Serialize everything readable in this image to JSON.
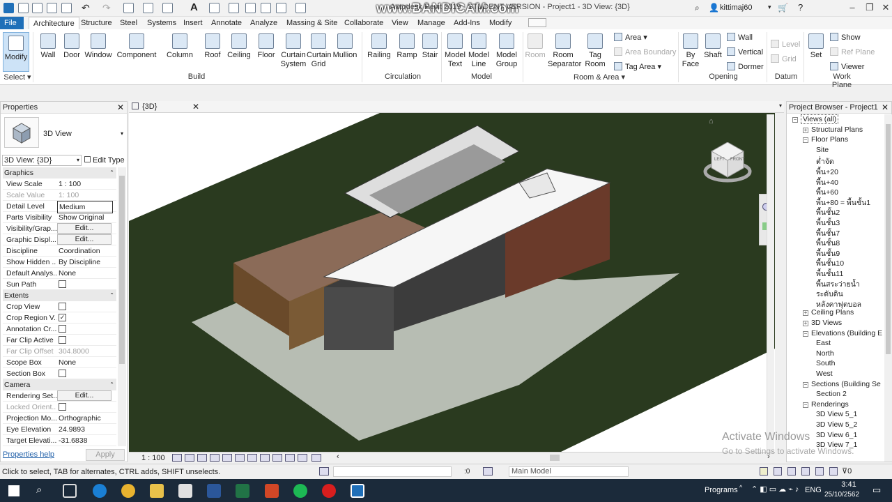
{
  "titlebar": {
    "title": "Autodesk Revit 2019 - STUDENT VERSION - Project1 - 3D View: {3D}",
    "watermark": "www.BANDICAM.com",
    "user": "kittimaj60"
  },
  "tabs": [
    "File",
    "Architecture",
    "Structure",
    "Steel",
    "Systems",
    "Insert",
    "Annotate",
    "Analyze",
    "Massing & Site",
    "Collaborate",
    "View",
    "Manage",
    "Add-Ins",
    "Modify"
  ],
  "ribbon": {
    "modify": "Modify",
    "select": "Select",
    "build_items": [
      "Wall",
      "Door",
      "Window",
      "Component",
      "Column",
      "Roof",
      "Ceiling",
      "Floor",
      "Curtain System",
      "Curtain Grid",
      "Mullion"
    ],
    "build_group": "Build",
    "circulation_items": [
      "Railing",
      "Ramp",
      "Stair"
    ],
    "circulation_group": "Circulation",
    "model_items": [
      "Model Text",
      "Model Line",
      "Model Group"
    ],
    "model_group": "Model",
    "room_items": [
      "Room",
      "Room Separator",
      "Tag Room"
    ],
    "room_small": [
      "Area",
      "Area Boundary",
      "Tag Area"
    ],
    "room_group": "Room & Area",
    "opening_items": [
      "By Face",
      "Shaft"
    ],
    "opening_small": [
      "Wall",
      "Vertical",
      "Dormer"
    ],
    "opening_group": "Opening",
    "datum_small": [
      "Level",
      "Grid"
    ],
    "datum_group": "Datum",
    "workplane_set": "Set",
    "workplane_small": [
      "Show",
      "Ref Plane",
      "Viewer"
    ],
    "workplane_group": "Work Plane"
  },
  "properties": {
    "header": "Properties",
    "type_name": "3D View",
    "selector": "3D View: {3D}",
    "edit_type": "Edit Type",
    "sections": {
      "graphics": "Graphics",
      "extents": "Extents",
      "camera": "Camera"
    },
    "graphics_rows": [
      {
        "k": "View Scale",
        "v": "1 : 100"
      },
      {
        "k": "Scale Value",
        "v": "1: 100"
      },
      {
        "k": "Detail Level",
        "v": "Medium"
      },
      {
        "k": "Parts Visibility",
        "v": "Show Original"
      },
      {
        "k": "Visibility/Grap...",
        "v": "Edit..."
      },
      {
        "k": "Graphic Displ...",
        "v": "Edit..."
      },
      {
        "k": "Discipline",
        "v": "Coordination"
      },
      {
        "k": "Show Hidden ...",
        "v": "By Discipline"
      },
      {
        "k": "Default Analys...",
        "v": "None"
      },
      {
        "k": "Sun Path",
        "v": ""
      }
    ],
    "extents_rows": [
      {
        "k": "Crop View",
        "v": ""
      },
      {
        "k": "Crop Region V...",
        "v": "✓"
      },
      {
        "k": "Annotation Cr...",
        "v": ""
      },
      {
        "k": "Far Clip Active",
        "v": ""
      },
      {
        "k": "Far Clip Offset",
        "v": "304.8000"
      },
      {
        "k": "Scope Box",
        "v": "None"
      },
      {
        "k": "Section Box",
        "v": ""
      }
    ],
    "camera_rows": [
      {
        "k": "Rendering Set...",
        "v": "Edit..."
      },
      {
        "k": "Locked Orient...",
        "v": ""
      },
      {
        "k": "Projection Mo...",
        "v": "Orthographic"
      },
      {
        "k": "Eye Elevation",
        "v": "24.9893"
      },
      {
        "k": "Target Elevati...",
        "v": "-31.6838"
      }
    ],
    "help": "Properties help",
    "apply": "Apply"
  },
  "view_tab": {
    "label": "{3D}"
  },
  "view_bar": {
    "scale": "1 : 100"
  },
  "browser": {
    "header": "Project Browser - Project1",
    "items": [
      {
        "label": "Views (all)",
        "level": 0,
        "box": "−"
      },
      {
        "label": "Structural Plans",
        "level": 1,
        "box": "+"
      },
      {
        "label": "Floor Plans",
        "level": 1,
        "box": "−"
      },
      {
        "label": "Site",
        "level": 2,
        "box": ""
      },
      {
        "label": "ต่ำจัด",
        "level": 2,
        "box": ""
      },
      {
        "label": "พื้น+20",
        "level": 2,
        "box": ""
      },
      {
        "label": "พื้น+40",
        "level": 2,
        "box": ""
      },
      {
        "label": "พื้น+60",
        "level": 2,
        "box": ""
      },
      {
        "label": "พื้น+80 = พื้นชั้น1",
        "level": 2,
        "box": ""
      },
      {
        "label": "พื้นชั้น2",
        "level": 2,
        "box": ""
      },
      {
        "label": "พื้นชั้น3",
        "level": 2,
        "box": ""
      },
      {
        "label": "พื้นชั้น7",
        "level": 2,
        "box": ""
      },
      {
        "label": "พื้นชั้น8",
        "level": 2,
        "box": ""
      },
      {
        "label": "พื้นชั้น9",
        "level": 2,
        "box": ""
      },
      {
        "label": "พื้นชั้น10",
        "level": 2,
        "box": ""
      },
      {
        "label": "พื้นชั้น11",
        "level": 2,
        "box": ""
      },
      {
        "label": "พื้นสระว่ายน้ำ",
        "level": 2,
        "box": ""
      },
      {
        "label": "ระดับดิน",
        "level": 2,
        "box": ""
      },
      {
        "label": "หลังคาฟุตบอล",
        "level": 2,
        "box": ""
      },
      {
        "label": "Ceiling Plans",
        "level": 1,
        "box": "+"
      },
      {
        "label": "3D Views",
        "level": 1,
        "box": "+"
      },
      {
        "label": "Elevations (Building E",
        "level": 1,
        "box": "−"
      },
      {
        "label": "East",
        "level": 2,
        "box": ""
      },
      {
        "label": "North",
        "level": 2,
        "box": ""
      },
      {
        "label": "South",
        "level": 2,
        "box": ""
      },
      {
        "label": "West",
        "level": 2,
        "box": ""
      },
      {
        "label": "Sections (Building Se",
        "level": 1,
        "box": "−"
      },
      {
        "label": "Section 2",
        "level": 2,
        "box": ""
      },
      {
        "label": "Renderings",
        "level": 1,
        "box": "−"
      },
      {
        "label": "3D View 5_1",
        "level": 2,
        "box": ""
      },
      {
        "label": "3D View 5_2",
        "level": 2,
        "box": ""
      },
      {
        "label": "3D View 6_1",
        "level": 2,
        "box": ""
      },
      {
        "label": "3D View 7_1",
        "level": 2,
        "box": ""
      }
    ]
  },
  "watermark": {
    "line1": "Activate Windows",
    "line2": "Go to Settings to activate Windows."
  },
  "status": {
    "hint": "Click to select, TAB for alternates, CTRL adds, SHIFT unselects.",
    "zero": ":0",
    "model": "Main Model",
    "filter": "0"
  },
  "taskbar": {
    "programs": "Programs",
    "lang": "ENG",
    "time": "3:41",
    "date": "25/10/2562"
  },
  "viewcube": {
    "left": "LEFT",
    "front": "FRONT"
  }
}
